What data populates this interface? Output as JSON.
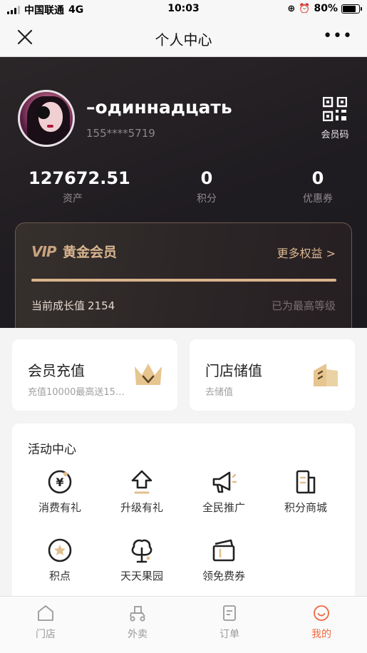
{
  "status_bar": {
    "carrier": "中国联通",
    "network": "4G",
    "time": "10:03",
    "battery": "80%",
    "battery_level": 0.8
  },
  "nav": {
    "title": "个人中心",
    "more": "•••"
  },
  "profile": {
    "name": "–одиннадцать",
    "phone": "155****5719",
    "qr_label": "会员码"
  },
  "stats": [
    {
      "value": "127672.51",
      "label": "资产"
    },
    {
      "value": "0",
      "label": "积分"
    },
    {
      "value": "0",
      "label": "优惠券"
    }
  ],
  "vip": {
    "badge": "VIP",
    "level": "黄金会员",
    "more": "更多权益 >",
    "growth_label": "当前成长值",
    "growth_value": "2154",
    "status": "已为最高等级",
    "progress": 1.0
  },
  "cards": [
    {
      "title": "会员充值",
      "subtitle": "充值10000最高送15…",
      "icon": "crown-icon"
    },
    {
      "title": "门店储值",
      "subtitle": "去储值",
      "icon": "store-card-icon"
    }
  ],
  "activity": {
    "title": "活动中心",
    "items": [
      {
        "label": "消费有礼",
        "icon": "yen-coin-icon"
      },
      {
        "label": "升级有礼",
        "icon": "upgrade-arrow-icon"
      },
      {
        "label": "全民推广",
        "icon": "megaphone-icon"
      },
      {
        "label": "积分商城",
        "icon": "points-mall-icon"
      },
      {
        "label": "积点",
        "icon": "star-coin-icon"
      },
      {
        "label": "天天果园",
        "icon": "tree-icon"
      },
      {
        "label": "领免费券",
        "icon": "coupon-icon"
      }
    ]
  },
  "tabs": [
    {
      "label": "门店",
      "icon": "store-icon",
      "active": false
    },
    {
      "label": "外卖",
      "icon": "delivery-icon",
      "active": false
    },
    {
      "label": "订单",
      "icon": "order-icon",
      "active": false
    },
    {
      "label": "我的",
      "icon": "smile-icon",
      "active": true
    }
  ],
  "colors": {
    "accent": "#f0683f",
    "gold": "#d9b690",
    "header_bg": "#211e23",
    "icon_gold": "#e2bf8e"
  }
}
